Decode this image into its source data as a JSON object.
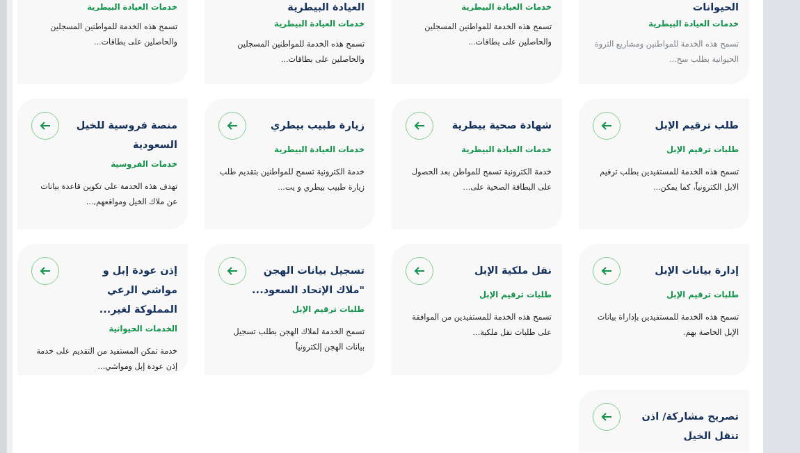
{
  "cards": [
    {
      "kind": "partial",
      "title": "الحيوانات",
      "category": "خدمات العيادة البيطرية",
      "description": "تسمح هذه الخدمة للمواطنين ومشاريع الثروة الحيوانية بطلب سح...",
      "muted": true
    },
    {
      "kind": "partial",
      "category": "خدمات العيادة البيطرية",
      "description": "تسمح هذه الخدمة للمواطنين المسجلين والحاصلين على بطاقات...",
      "muted": false
    },
    {
      "kind": "partial",
      "title": "العيادة البيطرية",
      "category": "خدمات العيادة البيطرية",
      "description": "تسمح هذه الخدمة للمواطنين المسجلين والحاصلين على بطاقات...",
      "muted": false
    },
    {
      "kind": "partial",
      "category": "خدمات العيادة البيطرية",
      "description": "تسمح هذه الخدمة للمواطنين المسجلين والحاصلين على بطاقات...",
      "muted": false
    },
    {
      "kind": "full",
      "title": "طلب ترقيم الإبل",
      "category": "طلبات ترقيم الإبل",
      "description": "تسمح هذه الخدمة للمستفيدين بطلب ترقيم الابل الكترونياً، كما يمكن...",
      "muted": false
    },
    {
      "kind": "full",
      "title": "شهادة صحية بيطرية",
      "category": "خدمات العيادة البيطرية",
      "description": "خدمة الكترونية تسمح للمواطن بعد الحصول على البطاقة الصحية على...",
      "muted": false
    },
    {
      "kind": "full",
      "title": "زيارة طبيب بيطري",
      "category": "خدمات العيادة البيطرية",
      "description": "خدمة الكترونية تسمح للمواطنين بتقديم طلب زيارة طبيب بيطري و يت...",
      "muted": false
    },
    {
      "kind": "full",
      "title": "منصة فروسية للخيل السعودية",
      "category": "خدمات الفروسية",
      "description": "تهدف هذه الخدمة على تكوين قاعدة بيانات عن ملاك الخيل ومواقعهم,...",
      "muted": false
    },
    {
      "kind": "full",
      "title": "إدارة بيانات الإبل",
      "category": "طلبات ترقيم الإبل",
      "description": "تسمح هذه الخدمة للمستفيدين بإداراة بيانات الإبل الخاصة بهم.",
      "muted": false
    },
    {
      "kind": "full",
      "title": "نقل ملكية الإبل",
      "category": "طلبات ترقيم الإبل",
      "description": "تسمح هذه الخدمة للمستفيدين من الموافقة على طلبات نقل ملكية...",
      "muted": false
    },
    {
      "kind": "full",
      "title": "تسجيل بيانات الهجن \"ملاك الإتحاد السعود...",
      "category": "طلبات ترقيم الإبل",
      "description": "تسمح الخدمة لملاك الهجن بطلب تسجيل بيانات الهجن إلكترونياً",
      "muted": false
    },
    {
      "kind": "full",
      "title": "إذن عودة إبل و مواشي الرعي المملوكة لغير...",
      "category": "الخدمات الحيوانية",
      "description": "خدمة تمكن المستفيد من التقديم على خدمة إذن عودة إبل ومواشي...",
      "muted": false
    },
    {
      "kind": "clipped",
      "title": "تصريح مشاركة/ اذن تنقل الخيل"
    }
  ]
}
